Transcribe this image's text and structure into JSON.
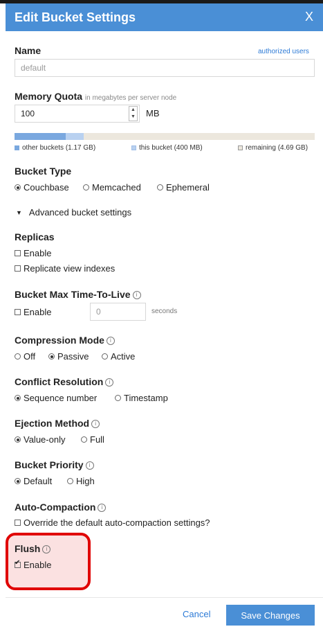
{
  "header": {
    "title": "Edit Bucket Settings",
    "close": "X"
  },
  "name": {
    "label": "Name",
    "authorized_users": "authorized users",
    "value": "default"
  },
  "memory": {
    "label": "Memory Quota",
    "sublabel": "in megabytes per server node",
    "value": "100",
    "unit": "MB",
    "legend": {
      "other": "other buckets (1.17 GB)",
      "this": "this bucket (400 MB)",
      "remaining": "remaining (4.69 GB)"
    },
    "bar_fractions": {
      "other": 0.17,
      "this": 0.06
    },
    "colors": {
      "other": "#7aa8df",
      "this": "#b9d1f0",
      "remaining": "#ece7dd"
    }
  },
  "bucket_type": {
    "label": "Bucket Type",
    "options": [
      "Couchbase",
      "Memcached",
      "Ephemeral"
    ],
    "selected": "Couchbase"
  },
  "advanced": {
    "label": "Advanced bucket settings"
  },
  "replicas": {
    "label": "Replicas",
    "enable": "Enable",
    "replicate": "Replicate view indexes"
  },
  "ttl": {
    "label": "Bucket Max Time-To-Live",
    "enable": "Enable",
    "value": "0",
    "unit": "seconds"
  },
  "compression": {
    "label": "Compression Mode",
    "options": [
      "Off",
      "Passive",
      "Active"
    ],
    "selected": "Passive"
  },
  "conflict": {
    "label": "Conflict Resolution",
    "options": [
      "Sequence number",
      "Timestamp"
    ],
    "selected": "Sequence number"
  },
  "ejection": {
    "label": "Ejection Method",
    "options": [
      "Value-only",
      "Full"
    ],
    "selected": "Value-only"
  },
  "priority": {
    "label": "Bucket Priority",
    "options": [
      "Default",
      "High"
    ],
    "selected": "Default"
  },
  "compaction": {
    "label": "Auto-Compaction",
    "override": "Override the default auto-compaction settings?"
  },
  "flush": {
    "label": "Flush",
    "enable": "Enable",
    "checked": true
  },
  "footer": {
    "cancel": "Cancel",
    "save": "Save Changes"
  },
  "colors": {
    "accent": "#4a8fd6",
    "highlight": "#e00000"
  }
}
